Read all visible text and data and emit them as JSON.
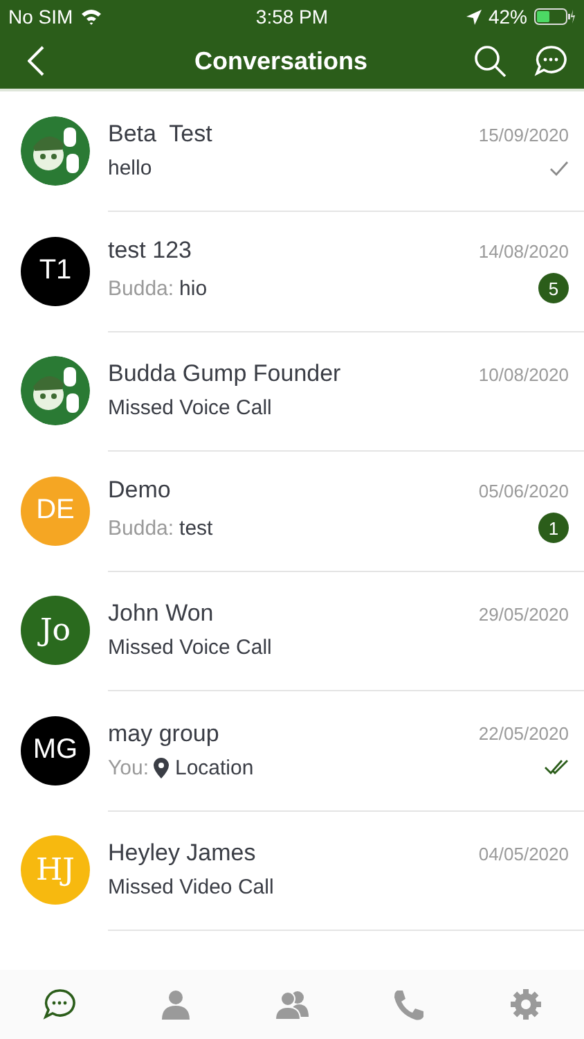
{
  "status_bar": {
    "carrier": "No SIM",
    "time": "3:58 PM",
    "battery": "42%"
  },
  "nav": {
    "title": "Conversations"
  },
  "conversations": [
    {
      "name": "Beta  Test",
      "date": "15/09/2020",
      "preview": {
        "text": "hello"
      },
      "read": false
    },
    {
      "name": "test 123",
      "date": "14/08/2020",
      "avatar": {
        "kind": "initials",
        "text": "T1",
        "color": "#000000"
      },
      "preview": {
        "sender": "Budda:",
        "text": "hio"
      },
      "unread": "5"
    },
    {
      "name": "Budda Gump Founder",
      "date": "10/08/2020",
      "preview": {
        "text": "Missed Voice Call"
      }
    },
    {
      "name": "Demo",
      "date": "05/06/2020",
      "avatar": {
        "kind": "initials",
        "text": "DE",
        "color": "#f5a623"
      },
      "preview": {
        "sender": "Budda:",
        "text": "test"
      },
      "unread": "1"
    },
    {
      "name": "John Won",
      "date": "29/05/2020",
      "avatar": {
        "kind": "initials",
        "text": "Jo",
        "color": "#2a6a1e",
        "serif": true
      },
      "preview": {
        "text": "Missed Voice Call"
      }
    },
    {
      "name": "may group",
      "date": "22/05/2020",
      "avatar": {
        "kind": "initials",
        "text": "MG",
        "color": "#000000"
      },
      "preview": {
        "sender": "You:",
        "location": true,
        "text": "Location"
      },
      "read": true
    },
    {
      "name": "Heyley James",
      "date": "04/05/2020",
      "avatar": {
        "kind": "initials",
        "text": "HJ",
        "color": "#f7b90f",
        "serif": true
      },
      "preview": {
        "text": "Missed Video Call"
      }
    }
  ],
  "tabs": [
    {
      "kind": "chats",
      "selected": true
    },
    {
      "kind": "contact",
      "selected": false
    },
    {
      "kind": "groups",
      "selected": false
    },
    {
      "kind": "calls",
      "selected": false
    },
    {
      "kind": "settings",
      "selected": false
    }
  ]
}
